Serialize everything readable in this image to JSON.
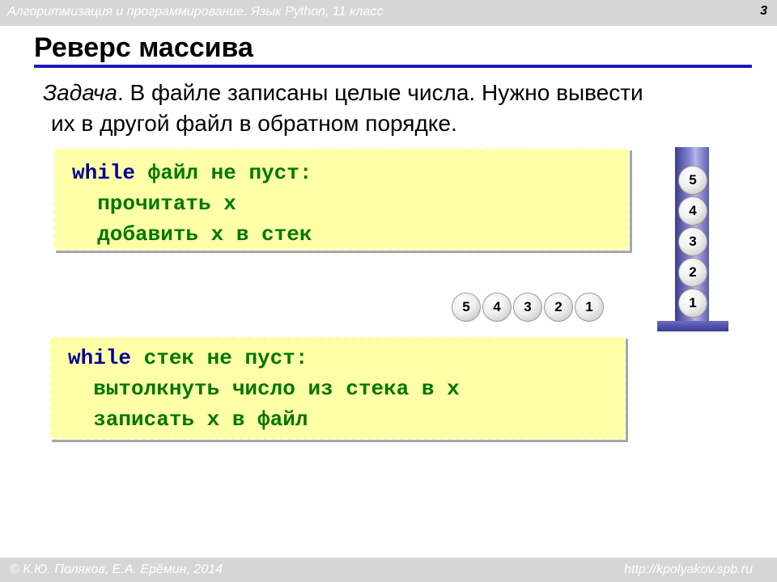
{
  "header": {
    "subtitle": "Алгоритмизация и программирование. Язык Python, 11 класс",
    "page_number": "3"
  },
  "slide": {
    "title": "Реверс массива",
    "task_label": "Задача",
    "task_text_1": ". В файле записаны целые числа. Нужно вывести",
    "task_text_2": "их в другой файл в обратном порядке."
  },
  "code_block_1": {
    "line1_keyword": "while",
    "line1_rest": " файл не пуст:",
    "line2": "  прочитать x",
    "line3": "  добавить x в стек"
  },
  "code_block_2": {
    "line1_keyword": "while",
    "line1_rest": " стек не пуст:",
    "line2": "  вытолкнуть число из стека в x",
    "line3": "  записать x в файл"
  },
  "stack": {
    "balls": [
      "5",
      "4",
      "3",
      "2",
      "1"
    ]
  },
  "sequence": {
    "balls": [
      "5",
      "4",
      "3",
      "2",
      "1"
    ]
  },
  "footer": {
    "copyright": "© К.Ю. Поляков, Е.А. Ерёмин, 2014",
    "url": "http://kpolyakov.spb.ru"
  }
}
